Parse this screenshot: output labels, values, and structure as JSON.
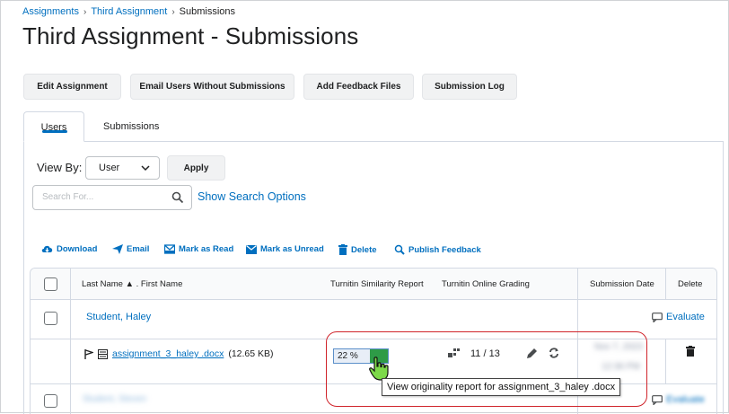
{
  "breadcrumb": {
    "items": [
      "Assignments",
      "Third Assignment"
    ],
    "current": "Submissions"
  },
  "page_title": "Third Assignment - Submissions",
  "toolbar": {
    "edit_assignment": "Edit Assignment",
    "email_users": "Email Users Without Submissions",
    "add_feedback": "Add Feedback Files",
    "submission_log": "Submission Log"
  },
  "tabs": [
    "Users",
    "Submissions"
  ],
  "view_by": {
    "label": "View By:",
    "selected": "User",
    "apply": "Apply"
  },
  "search": {
    "placeholder": "Search For...",
    "options_link": "Show Search Options"
  },
  "actions": [
    "Download",
    "Email",
    "Mark as Read",
    "Mark as Unread",
    "Delete",
    "Publish Feedback"
  ],
  "table": {
    "headers": {
      "name": "Last Name",
      "first": ". First Name",
      "similarity": "Turnitin Similarity Report",
      "grading": "Turnitin Online Grading",
      "date": "Submission Date",
      "delete": "Delete"
    },
    "rows": [
      {
        "user": "Student, Haley",
        "evaluate": "Evaluate",
        "file": "assignment_3_haley .docx",
        "size": "(12.65 KB)",
        "similarity": "22 %",
        "grade": "11 / 13",
        "date_line1": "Nov 7, 2023",
        "date_line2": "12:36 PM"
      },
      {
        "user": "Student, Steven",
        "evaluate": "Evaluate"
      }
    ]
  },
  "tooltip": "View originality report for assignment_3_haley .docx",
  "colors": {
    "link": "#006fbf",
    "highlight": "#d0242b",
    "similarity_green": "#2e9b47"
  }
}
